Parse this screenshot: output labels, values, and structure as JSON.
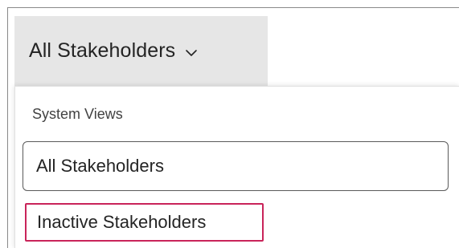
{
  "view_selector": {
    "current_view": "All Stakeholders",
    "icon": "chevron-down-icon"
  },
  "dropdown": {
    "section_header": "System Views",
    "options": [
      {
        "label": "All Stakeholders",
        "state": "selected"
      },
      {
        "label": "Inactive Stakeholders",
        "state": "highlighted"
      }
    ],
    "highlight_color": "#c9245a"
  }
}
